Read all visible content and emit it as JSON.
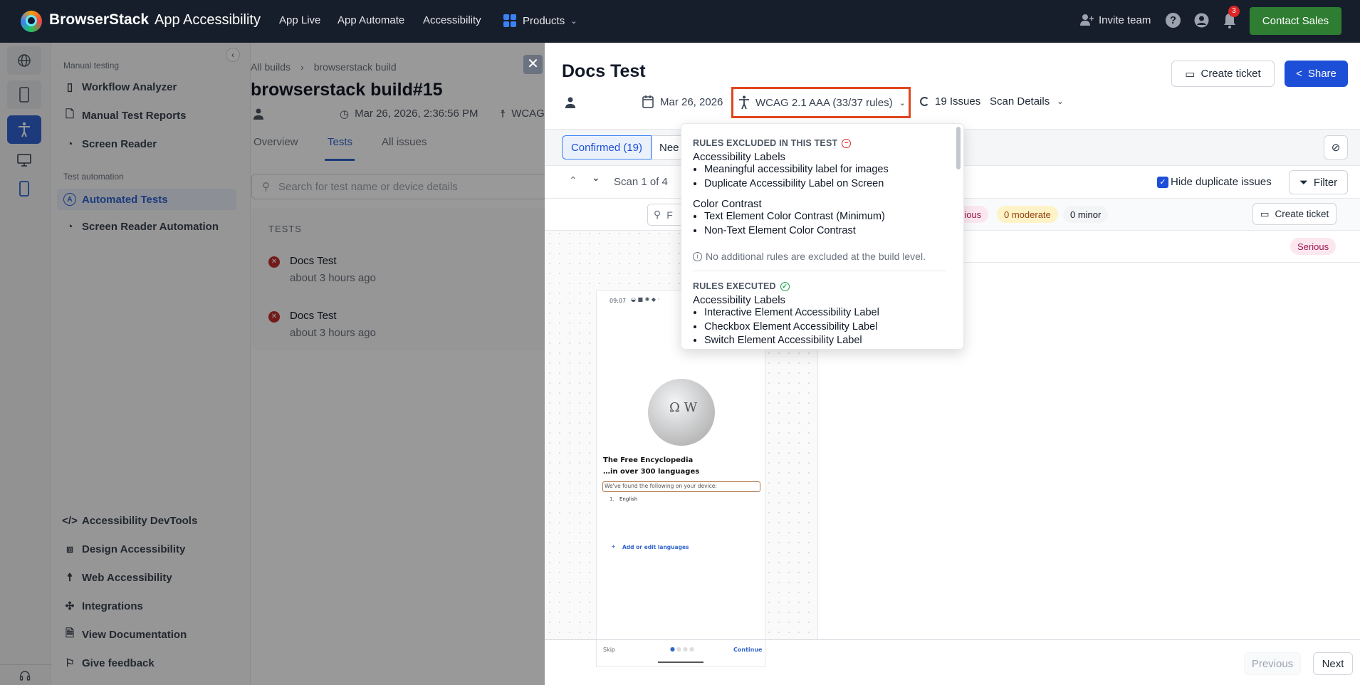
{
  "nav": {
    "brand": "BrowserStack",
    "product": "App Accessibility",
    "links": [
      "App Live",
      "App Automate",
      "Accessibility"
    ],
    "products_label": "Products",
    "invite_label": "Invite team",
    "notification_count": "3",
    "contact_sales": "Contact Sales",
    "contact_color": "#2e7d32"
  },
  "sidebar": {
    "section_manual": "Manual testing",
    "manual_items": [
      "Workflow Analyzer",
      "Manual Test Reports",
      "Screen Reader"
    ],
    "section_automation": "Test automation",
    "automation_items": [
      "Automated Tests",
      "Screen Reader Automation"
    ],
    "active_item": "Automated Tests",
    "footer_items": [
      "Accessibility DevTools",
      "Design Accessibility",
      "Web Accessibility",
      "Integrations",
      "View Documentation",
      "Give feedback"
    ]
  },
  "build": {
    "breadcrumb": [
      "All builds",
      "browserstack build"
    ],
    "title": "browserstack build#15",
    "date": "Mar 26, 2026, 2:36:56 PM",
    "standard_truncated": "WCAG",
    "tabs": [
      "Overview",
      "Tests",
      "All issues"
    ],
    "active_tab": "Tests",
    "search_placeholder": "Search for test name or device details",
    "tests_header": "TESTS",
    "tests": [
      {
        "name": "Docs Test",
        "time": "about 3 hours ago",
        "status": "failed"
      },
      {
        "name": "Docs Test",
        "time": "about 3 hours ago",
        "status": "failed"
      }
    ]
  },
  "drawer": {
    "title": "Docs Test",
    "create_ticket": "Create ticket",
    "share": "Share",
    "date": "Mar 26, 2026",
    "standard": "WCAG 2.1 AAA (33/37 rules)",
    "issues": "19 Issues",
    "scan_details": "Scan Details",
    "tabs": [
      "Confirmed (19)",
      "Nee"
    ],
    "scan_label": "Scan 1 of 4",
    "hide_duplicates": "Hide duplicate issues",
    "hide_duplicates_checked": true,
    "filter": "Filter",
    "search_placeholder_truncated": "F",
    "severity": {
      "serious_truncated": "rious",
      "moderate": "0 moderate",
      "minor": "0 minor"
    },
    "row_badge": "Serious",
    "create_ticket_small": "Create ticket",
    "previous": "Previous",
    "next": "Next",
    "accent": "#1d4ed8",
    "highlight_border": "#e0461f"
  },
  "popover": {
    "excluded_heading": "RULES EXCLUDED IN THIS TEST",
    "excluded_groups": [
      {
        "name": "Accessibility Labels",
        "rules": [
          "Meaningful accessibility label for images",
          "Duplicate Accessibility Label on Screen"
        ]
      },
      {
        "name": "Color Contrast",
        "rules": [
          "Text Element Color Contrast (Minimum)",
          "Non-Text Element Color Contrast"
        ]
      }
    ],
    "build_note": "No additional rules are excluded at the build level.",
    "executed_heading": "RULES EXECUTED",
    "executed_groups": [
      {
        "name": "Accessibility Labels",
        "rules": [
          "Interactive Element Accessibility Label",
          "Checkbox Element Accessibility Label",
          "Switch Element Accessibility Label"
        ]
      }
    ]
  },
  "device_screen": {
    "status_time": "09:07",
    "headline_1": "The Free Encyclopedia",
    "headline_2": "…in over 300 languages",
    "found_text": "We've found the following on your device:",
    "language_num": "1.",
    "language": "English",
    "add_languages": "Add or edit languages",
    "skip": "Skip",
    "continue": "Continue"
  }
}
